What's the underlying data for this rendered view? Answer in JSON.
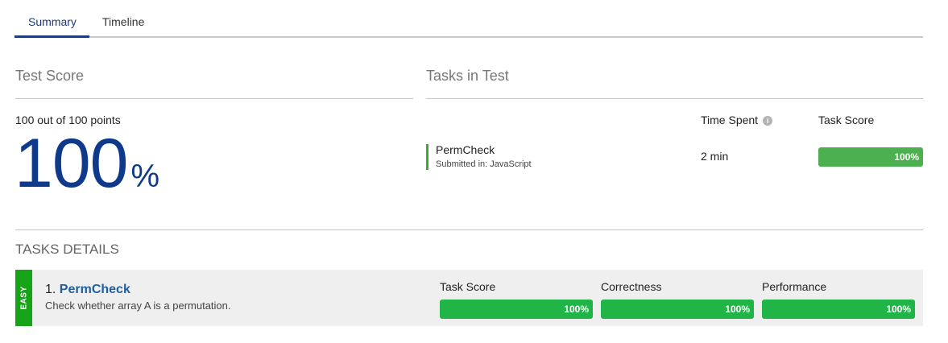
{
  "tabs": [
    {
      "label": "Summary",
      "active": true
    },
    {
      "label": "Timeline",
      "active": false
    }
  ],
  "test_score": {
    "title": "Test Score",
    "points_text": "100 out of 100 points",
    "value": "100",
    "unit": "%"
  },
  "tasks_in_test": {
    "title": "Tasks in Test",
    "columns": {
      "time_spent": "Time Spent",
      "task_score": "Task Score"
    },
    "info_icon": "i",
    "tasks": [
      {
        "name": "PermCheck",
        "submitted": "Submitted in: JavaScript",
        "time": "2 min",
        "score_label": "100%",
        "score": 100
      }
    ]
  },
  "task_details": {
    "title": "TASKS DETAILS",
    "items": [
      {
        "difficulty": "EASY",
        "number": "1.",
        "name": "PermCheck",
        "description": "Check whether array A is a permutation.",
        "metrics": [
          {
            "name": "Task Score",
            "label": "100%",
            "value": 100
          },
          {
            "name": "Correctness",
            "label": "100%",
            "value": 100
          },
          {
            "name": "Performance",
            "label": "100%",
            "value": 100
          }
        ]
      }
    ]
  },
  "colors": {
    "accent_blue": "#0f3a8c",
    "tab_active": "#1b3d7a",
    "bar_green_task": "#4caf50",
    "bar_green_detail": "#21b548",
    "easy_green": "#17a318"
  }
}
